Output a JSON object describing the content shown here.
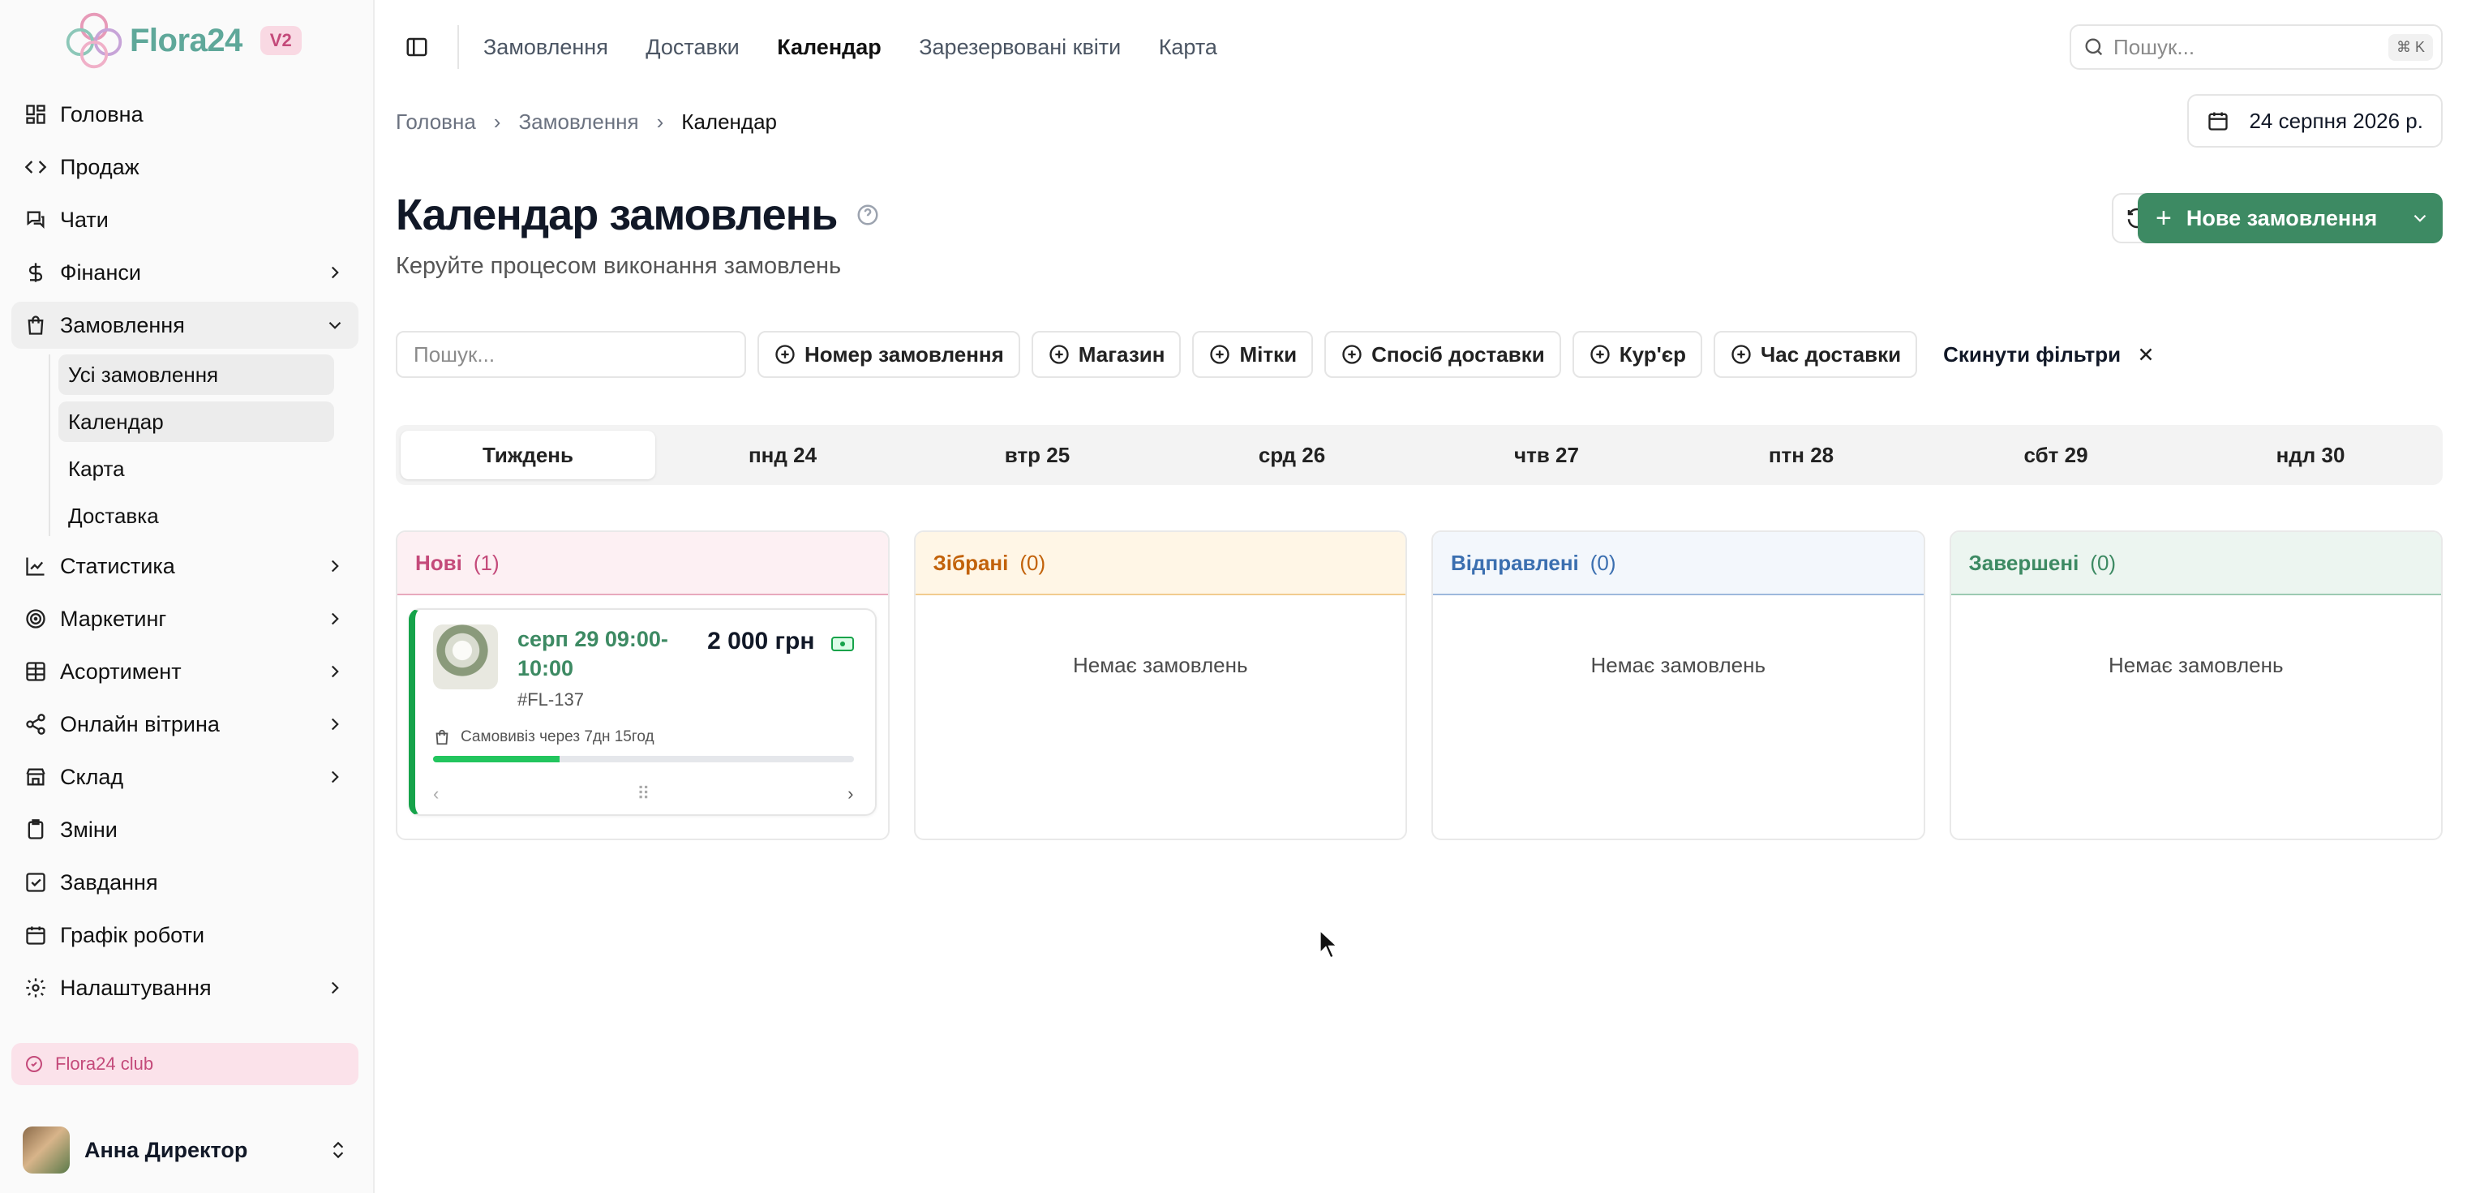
{
  "app": {
    "name": "Flora24",
    "version_badge": "V2"
  },
  "sidebar": {
    "items": [
      {
        "label": "Головна",
        "icon": "dashboard-icon"
      },
      {
        "label": "Продаж",
        "icon": "code-icon"
      },
      {
        "label": "Чати",
        "icon": "chat-icon"
      },
      {
        "label": "Фінанси",
        "icon": "dollar-icon"
      },
      {
        "label": "Замовлення",
        "icon": "bag-icon"
      },
      {
        "label": "Статистика",
        "icon": "chart-line-icon"
      },
      {
        "label": "Маркетинг",
        "icon": "target-icon"
      },
      {
        "label": "Асортимент",
        "icon": "grid-icon"
      },
      {
        "label": "Онлайн вітрина",
        "icon": "share-icon"
      },
      {
        "label": "Склад",
        "icon": "store-icon"
      },
      {
        "label": "Зміни",
        "icon": "clipboard-icon"
      },
      {
        "label": "Завдання",
        "icon": "checkbox-icon"
      },
      {
        "label": "Графік роботи",
        "icon": "calendar-icon"
      },
      {
        "label": "Налаштування",
        "icon": "gear-icon"
      }
    ],
    "orders_sub": [
      "Усі замовлення",
      "Календар",
      "Карта",
      "Доставка"
    ],
    "club": "Flora24 club",
    "user_name": "Анна Директор"
  },
  "topbar": {
    "tabs": [
      "Замовлення",
      "Доставки",
      "Календар",
      "Зарезервовані квіти",
      "Карта"
    ],
    "active_tab": "Календар",
    "search_placeholder": "Пошук...",
    "shortcut": "⌘ K"
  },
  "breadcrumb": [
    "Головна",
    "Замовлення",
    "Календар"
  ],
  "date": "24 серпня 2026 р.",
  "page": {
    "title": "Календар замовлень",
    "subtitle": "Керуйте процесом виконання замовлень",
    "new_order": "Нове замовлення"
  },
  "filters": {
    "search_placeholder": "Пошук...",
    "chips": [
      "Номер замовлення",
      "Магазин",
      "Мітки",
      "Спосіб доставки",
      "Кур'єр",
      "Час доставки"
    ],
    "reset": "Скинути фільтри"
  },
  "days": [
    "Тиждень",
    "пнд 24",
    "втр 25",
    "срд 26",
    "чтв 27",
    "птн 28",
    "сбт 29",
    "ндл 30"
  ],
  "columns": [
    {
      "title": "Нові",
      "count": "(1)",
      "color": "#c44a7a",
      "bg": "#fdf0f3",
      "border": "#e8a9bd",
      "empty": ""
    },
    {
      "title": "Зібрані",
      "count": "(0)",
      "color": "#c2620a",
      "bg": "#fff6e6",
      "border": "#f2cc8f",
      "empty": "Немає замовлень"
    },
    {
      "title": "Відправлені",
      "count": "(0)",
      "color": "#3b6fb0",
      "bg": "#f3f7fc",
      "border": "#9db8dc",
      "empty": "Немає замовлень"
    },
    {
      "title": "Завершені",
      "count": "(0)",
      "color": "#3d8a63",
      "bg": "#ecf5f0",
      "border": "#9ccab2",
      "empty": "Немає замовлень"
    }
  ],
  "order_card": {
    "when": "серп 29 09:00-10:00",
    "id": "#FL-137",
    "price": "2 000 грн",
    "pickup": "Самовивіз через 7дн 15год",
    "progress": 0.3
  }
}
